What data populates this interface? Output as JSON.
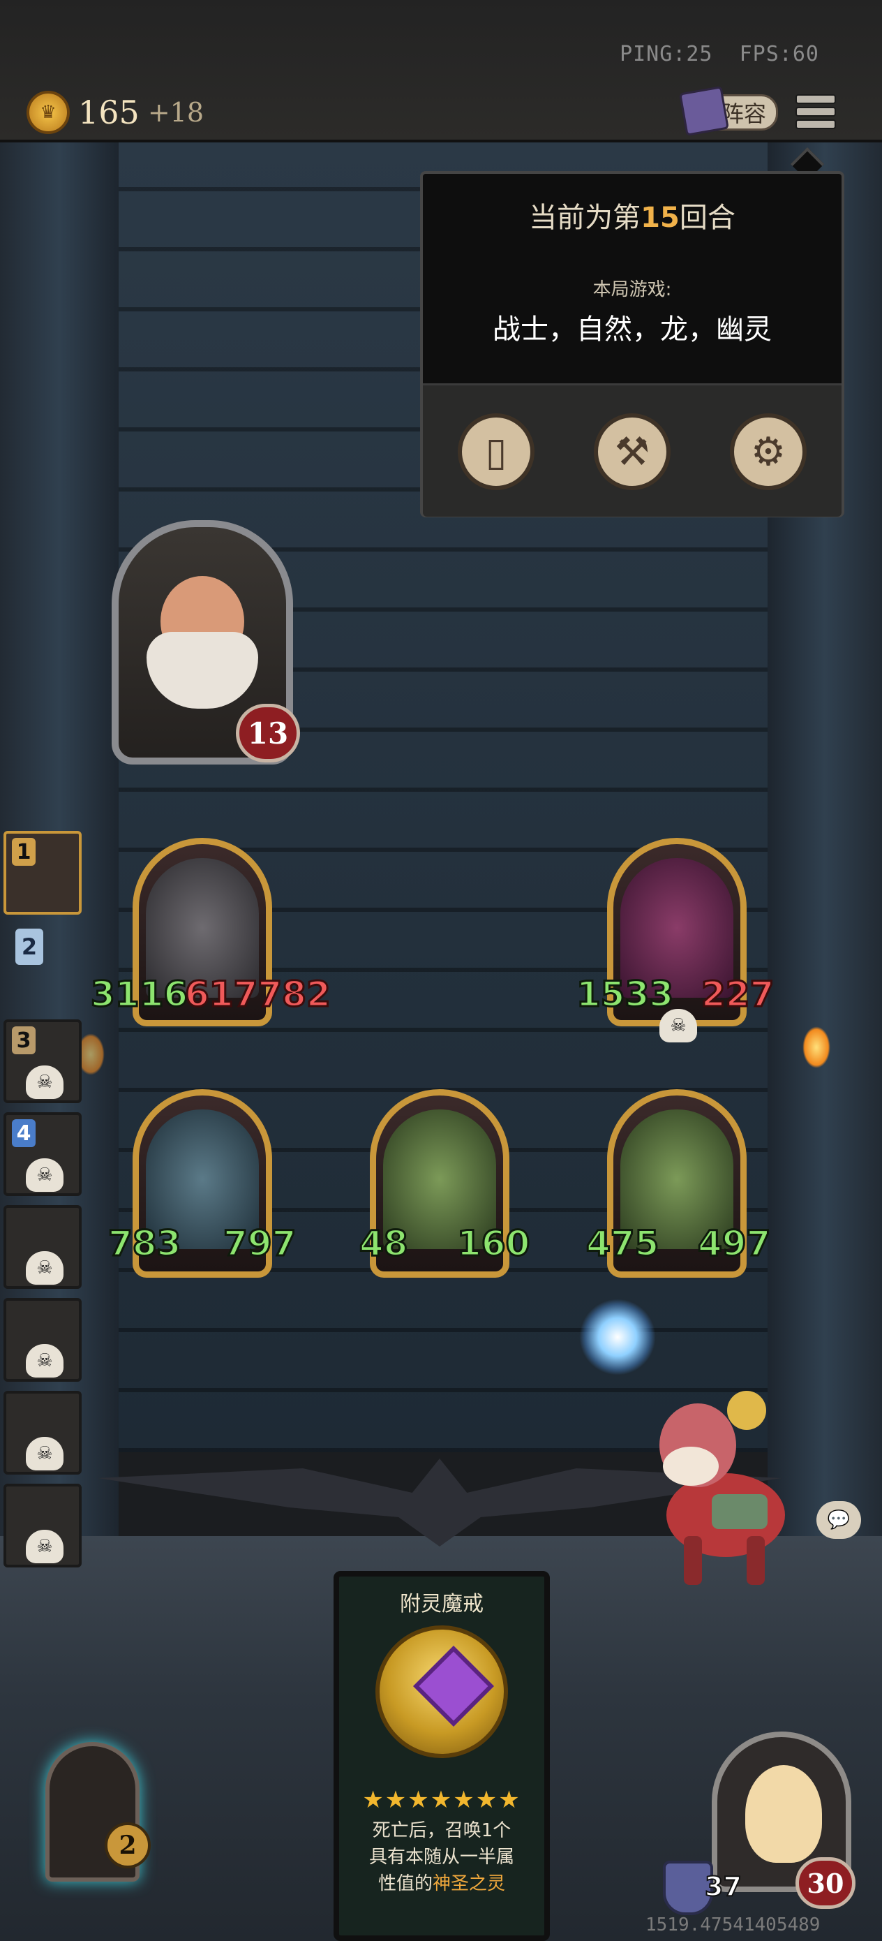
{
  "status": {
    "ping": "PING:25",
    "fps": "FPS:60"
  },
  "gold": {
    "amount": "165",
    "increment": "+18"
  },
  "toolbar": {
    "roster_label": "阵容"
  },
  "popup": {
    "round_prefix": "当前为第",
    "round_number": "15",
    "round_suffix": "回合",
    "game_label": "本局游戏:",
    "tribes": "战士，自然，龙，幽灵"
  },
  "hero": {
    "health": "13"
  },
  "left_rail": {
    "ranks": [
      "1",
      "2",
      "3",
      "4"
    ]
  },
  "board": {
    "minions": [
      {
        "attack": "3116",
        "health": "617782"
      },
      {
        "attack": "1533",
        "health": "227"
      },
      {
        "attack": "783",
        "health": "797"
      },
      {
        "attack": "48",
        "health": "160"
      },
      {
        "attack": "475",
        "health": "497"
      }
    ]
  },
  "item_card": {
    "title": "附灵魔戒",
    "stars": "★★★★★★★",
    "desc_line1": "死亡后，召唤1个",
    "desc_line2": "具有本随从一半属",
    "desc_line3_prefix": "性值的",
    "desc_line3_highlight": "神圣之灵"
  },
  "bottom": {
    "mirror_count": "2",
    "armor": "37",
    "player_health": "30",
    "coords": "1519.47541405489"
  }
}
